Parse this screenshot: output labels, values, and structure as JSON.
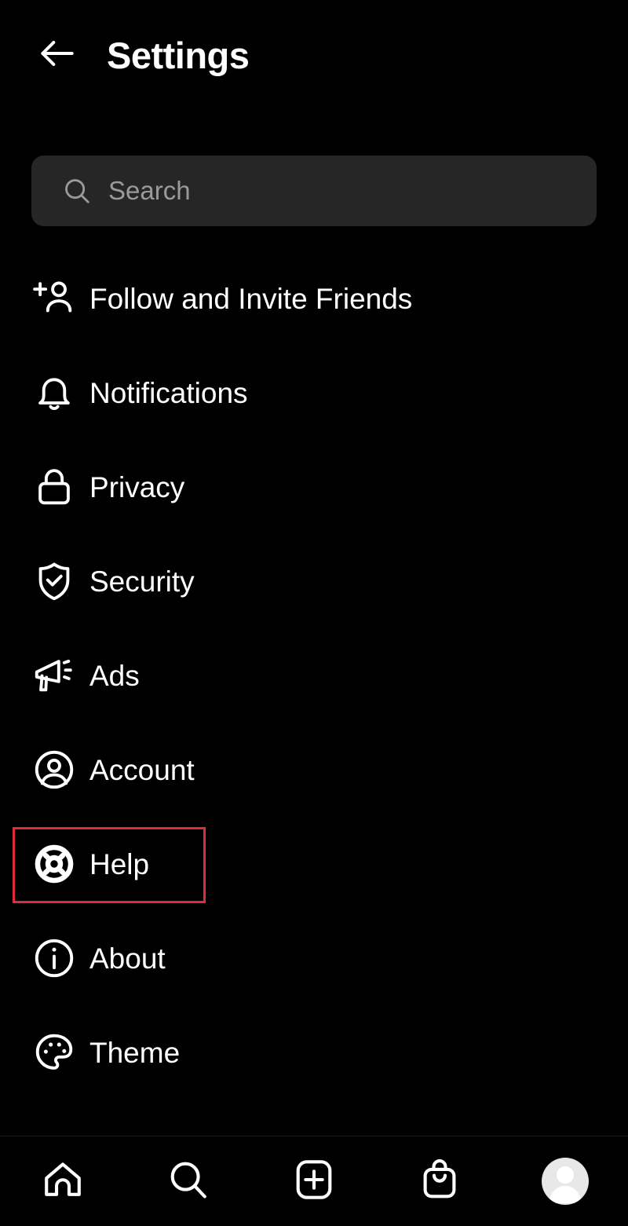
{
  "header": {
    "title": "Settings",
    "back_icon": "arrow-left-icon"
  },
  "search": {
    "placeholder": "Search",
    "value": "",
    "icon": "search-icon",
    "background_color": "#262626"
  },
  "settings_list": {
    "items": [
      {
        "label": "Follow and Invite Friends",
        "icon": "person-add-icon",
        "highlighted": false
      },
      {
        "label": "Notifications",
        "icon": "bell-icon",
        "highlighted": false
      },
      {
        "label": "Privacy",
        "icon": "lock-icon",
        "highlighted": false
      },
      {
        "label": "Security",
        "icon": "shield-check-icon",
        "highlighted": false
      },
      {
        "label": "Ads",
        "icon": "megaphone-icon",
        "highlighted": false
      },
      {
        "label": "Account",
        "icon": "account-circle-icon",
        "highlighted": false
      },
      {
        "label": "Help",
        "icon": "lifebuoy-icon",
        "highlighted": true
      },
      {
        "label": "About",
        "icon": "info-circle-icon",
        "highlighted": false
      },
      {
        "label": "Theme",
        "icon": "palette-icon",
        "highlighted": false
      }
    ]
  },
  "bottom_nav": {
    "items": [
      {
        "name": "home",
        "icon": "home-icon"
      },
      {
        "name": "search",
        "icon": "search-icon"
      },
      {
        "name": "create",
        "icon": "plus-square-icon"
      },
      {
        "name": "shop",
        "icon": "shopping-bag-icon"
      },
      {
        "name": "profile",
        "icon": "avatar-icon"
      }
    ]
  },
  "colors": {
    "background": "#000000",
    "text": "#ffffff",
    "placeholder": "#9a9a9a",
    "highlight": "#e02b3a",
    "search_field": "#262626"
  }
}
